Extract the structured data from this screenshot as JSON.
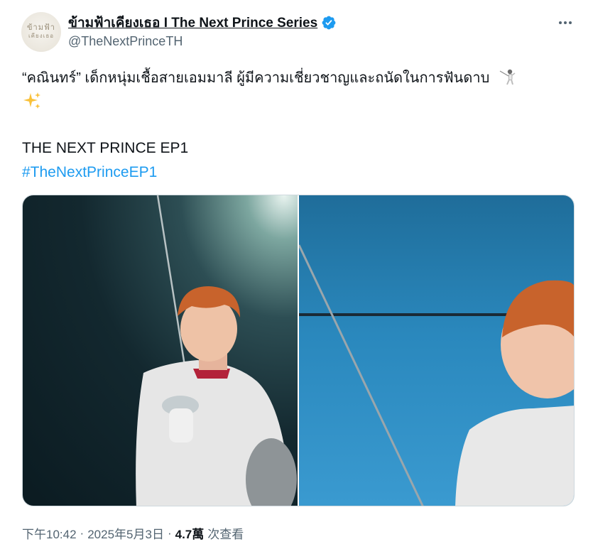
{
  "author": {
    "display_name": "ข้ามฟ้าเคียงเธอ I The Next Prince Series",
    "handle": "@TheNextPrinceTH",
    "verified": true,
    "avatar_logo_line1": "ข้ามฟ้า",
    "avatar_logo_line2": "เคียงเธอ"
  },
  "tweet": {
    "line1": "“คณินทร์” เด็กหนุ่มเชื้อสายเอมมาลี ผู้มีความเชี่ยวชาญและถนัดในการฟันดาบ",
    "line1_emoji": "person-fencing-emoji",
    "line2_emoji": "sparkles-emoji",
    "line3": "THE NEXT PRINCE EP1",
    "hashtag": "#TheNextPrinceEP1"
  },
  "media": {
    "photos": [
      "fencer-holding-foil",
      "fencer-closeup-blue-background"
    ]
  },
  "meta": {
    "time": "下午10:42",
    "date": "2025年5月3日",
    "separator": "·",
    "views_count": "4.7萬",
    "views_label": "次查看"
  },
  "colors": {
    "link": "#1d9bf0",
    "text": "#0f1419",
    "secondary": "#536471",
    "verified": "#1d9bf0"
  }
}
